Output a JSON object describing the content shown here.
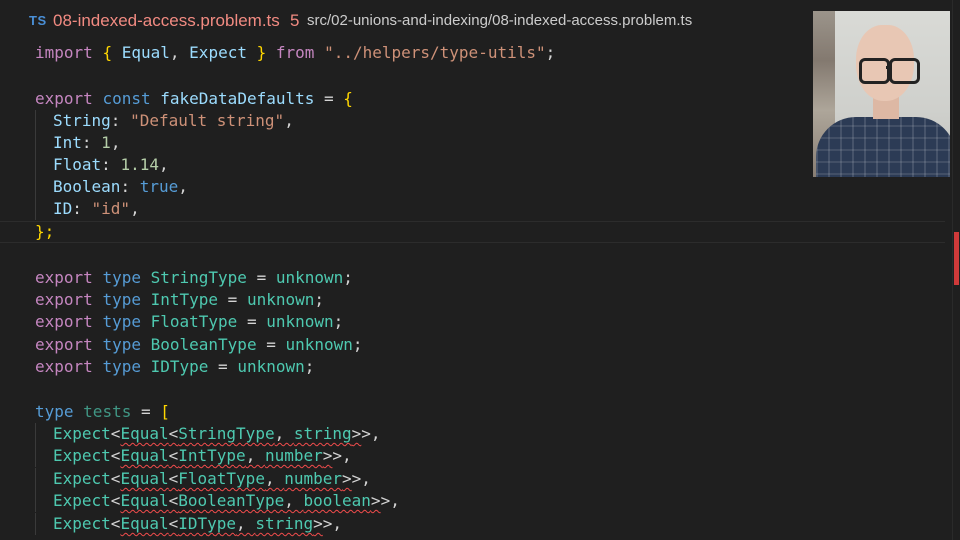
{
  "tab": {
    "language_badge": "TS",
    "filename": "08-indexed-access.problem.ts",
    "problem_count": "5",
    "path": "src/02-unions-and-indexing/08-indexed-access.problem.ts"
  },
  "code": {
    "import": {
      "kw_import": "import",
      "open": "{",
      "name1": "Equal",
      "comma": ",",
      "name2": "Expect",
      "close": "}",
      "kw_from": "from",
      "source": "\"../helpers/type-utils\"",
      "semi": ";"
    },
    "defaults": {
      "kw_export": "export",
      "kw_const": "const",
      "name": "fakeDataDefaults",
      "eq": "=",
      "open": "{",
      "close": "};",
      "props": [
        {
          "key": "String",
          "value": "\"Default string\""
        },
        {
          "key": "Int",
          "value": "1"
        },
        {
          "key": "Float",
          "value": "1.14"
        },
        {
          "key": "Boolean",
          "value": "true"
        },
        {
          "key": "ID",
          "value": "\"id\""
        }
      ]
    },
    "type_exports": [
      {
        "name": "StringType",
        "value": "unknown"
      },
      {
        "name": "IntType",
        "value": "unknown"
      },
      {
        "name": "FloatType",
        "value": "unknown"
      },
      {
        "name": "BooleanType",
        "value": "unknown"
      },
      {
        "name": "IDType",
        "value": "unknown"
      }
    ],
    "kw_export": "export",
    "kw_type": "type",
    "tests": {
      "kw_type": "type",
      "name": "tests",
      "eq": "=",
      "open": "[",
      "expect": "Expect",
      "equal": "Equal",
      "rows": [
        {
          "type": "StringType",
          "expected": "string"
        },
        {
          "type": "IntType",
          "expected": "number"
        },
        {
          "type": "FloatType",
          "expected": "number"
        },
        {
          "type": "BooleanType",
          "expected": "boolean"
        },
        {
          "type": "IDType",
          "expected": "string"
        }
      ]
    }
  },
  "colors": {
    "error": "#f14c4c",
    "keyword": "#c586c0",
    "type": "#4ec9b0",
    "string": "#ce9178"
  }
}
